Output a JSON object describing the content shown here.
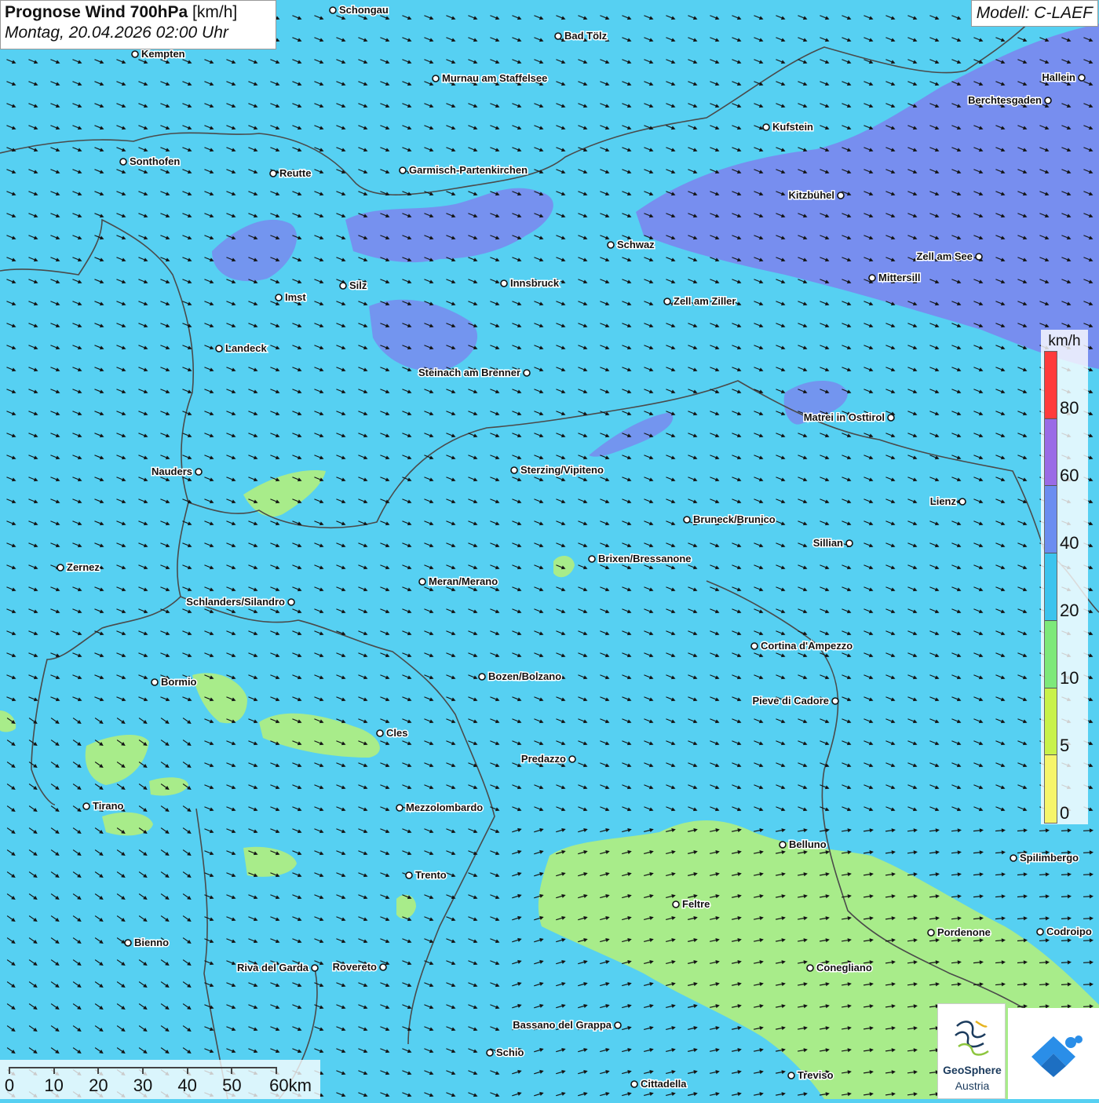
{
  "header": {
    "title_bold": "Prognose Wind 700hPa",
    "title_unit": " [km/h]",
    "datetime": "Montag, 20.04.2026 02:00 Uhr",
    "model": "Modell: C-LAEF"
  },
  "legend": {
    "unit": "km/h",
    "ticks": [
      "80",
      "60",
      "40",
      "20",
      "10",
      "5",
      "0"
    ],
    "colors": [
      "#ff3b3b",
      "#9a6be6",
      "#6b8df0",
      "#3cc4ee",
      "#7de97a",
      "#c8f24a",
      "#f6f56a"
    ]
  },
  "scale": {
    "labels": [
      "0",
      "10",
      "20",
      "30",
      "40",
      "50",
      "60km"
    ]
  },
  "logos": {
    "geosphere_name": "GeoSphere",
    "geosphere_sub": "Austria",
    "geosphere_icon": "geosphere-logo-icon",
    "app_icon": "wetter-app-logo-icon"
  },
  "colors": {
    "background_wind": "#56d0f2",
    "strong_wind": "#7b86ee",
    "weak_wind": "#a8ec8a",
    "arrow": "#141414"
  },
  "cities": [
    {
      "name": "Schongau",
      "label_side": "right"
    },
    {
      "name": "Bad Tölz",
      "label_side": "right"
    },
    {
      "name": "Kempten",
      "label_side": "right"
    },
    {
      "name": "Murnau am Staffelsee",
      "label_side": "right"
    },
    {
      "name": "Hallein",
      "label_side": "left"
    },
    {
      "name": "Berchtesgaden",
      "label_side": "left"
    },
    {
      "name": "Kufstein",
      "label_side": "right"
    },
    {
      "name": "Sonthofen",
      "label_side": "right"
    },
    {
      "name": "Reutte",
      "label_side": "right"
    },
    {
      "name": "Garmisch-Partenkirchen",
      "label_side": "right"
    },
    {
      "name": "Kitzbühel",
      "label_side": "left"
    },
    {
      "name": "Schwaz",
      "label_side": "right"
    },
    {
      "name": "Zell am See",
      "label_side": "left"
    },
    {
      "name": "Mittersill",
      "label_side": "right"
    },
    {
      "name": "Silz",
      "label_side": "right"
    },
    {
      "name": "Innsbruck",
      "label_side": "right"
    },
    {
      "name": "Imst",
      "label_side": "right"
    },
    {
      "name": "Zell am Ziller",
      "label_side": "right"
    },
    {
      "name": "Landeck",
      "label_side": "right"
    },
    {
      "name": "Steinach am Brenner",
      "label_side": "left"
    },
    {
      "name": "Matrei in Osttirol",
      "label_side": "left"
    },
    {
      "name": "Nauders",
      "label_side": "left"
    },
    {
      "name": "Sterzing/Vipiteno",
      "label_side": "right"
    },
    {
      "name": "Lienz",
      "label_side": "left"
    },
    {
      "name": "Bruneck/Brunico",
      "label_side": "right"
    },
    {
      "name": "Sillian",
      "label_side": "left"
    },
    {
      "name": "Zernez",
      "label_side": "right"
    },
    {
      "name": "Brixen/Bressanone",
      "label_side": "right"
    },
    {
      "name": "Meran/Merano",
      "label_side": "right"
    },
    {
      "name": "Schlanders/Silandro",
      "label_side": "left"
    },
    {
      "name": "Cortina d'Ampezzo",
      "label_side": "right"
    },
    {
      "name": "Bormio",
      "label_side": "right"
    },
    {
      "name": "Bozen/Bolzano",
      "label_side": "right"
    },
    {
      "name": "Pieve di Cadore",
      "label_side": "left"
    },
    {
      "name": "Cles",
      "label_side": "right"
    },
    {
      "name": "Predazzo",
      "label_side": "left"
    },
    {
      "name": "Tirano",
      "label_side": "right"
    },
    {
      "name": "Mezzolombardo",
      "label_side": "right"
    },
    {
      "name": "Belluno",
      "label_side": "right"
    },
    {
      "name": "Spilimbergo",
      "label_side": "right"
    },
    {
      "name": "Trento",
      "label_side": "right"
    },
    {
      "name": "Feltre",
      "label_side": "right"
    },
    {
      "name": "Pordenone",
      "label_side": "right"
    },
    {
      "name": "Codroipo",
      "label_side": "right"
    },
    {
      "name": "Bienno",
      "label_side": "right"
    },
    {
      "name": "Riva del Garda",
      "label_side": "left"
    },
    {
      "name": "Rovereto",
      "label_side": "left"
    },
    {
      "name": "Conegliano",
      "label_side": "right"
    },
    {
      "name": "Bassano del Grappa",
      "label_side": "left"
    },
    {
      "name": "Schio",
      "label_side": "right"
    },
    {
      "name": "Treviso",
      "label_side": "right"
    },
    {
      "name": "Cittadella",
      "label_side": "right"
    }
  ]
}
